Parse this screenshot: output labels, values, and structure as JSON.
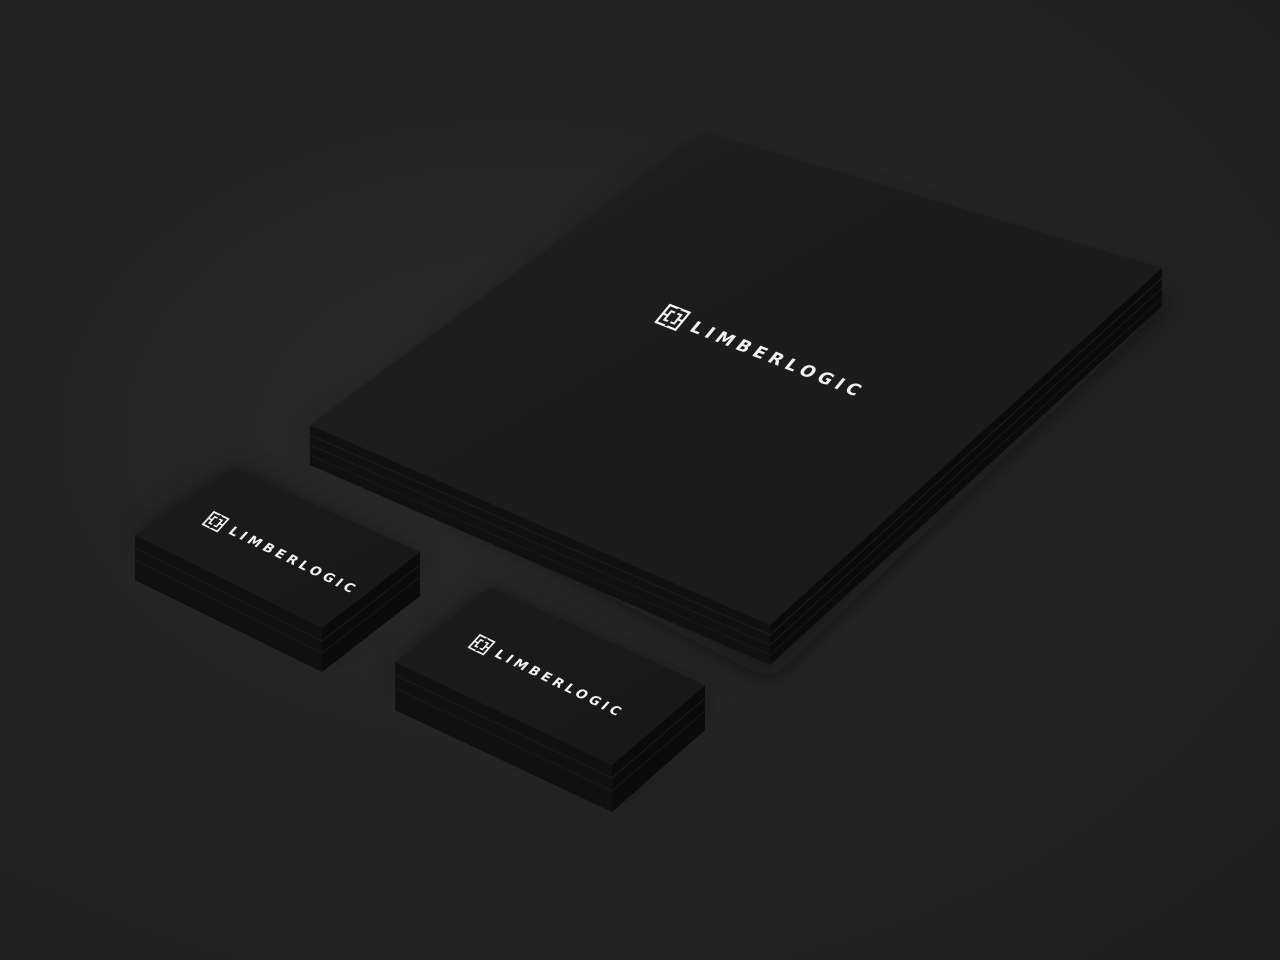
{
  "scene": {
    "description_colors": {
      "background": "#262626",
      "paper_top": "#1b1b1b",
      "paper_edge": "#0d0d0d",
      "logo": "#f2f2f2"
    }
  },
  "letterhead": {
    "brand_name": "LIMBERLOGIC",
    "logo_icon": "square-maze-icon"
  },
  "business_card_left": {
    "brand_name": "LIMBERLOGIC",
    "logo_icon": "square-maze-icon"
  },
  "business_card_right": {
    "brand_name": "LIMBERLOGIC",
    "logo_icon": "square-maze-icon"
  }
}
